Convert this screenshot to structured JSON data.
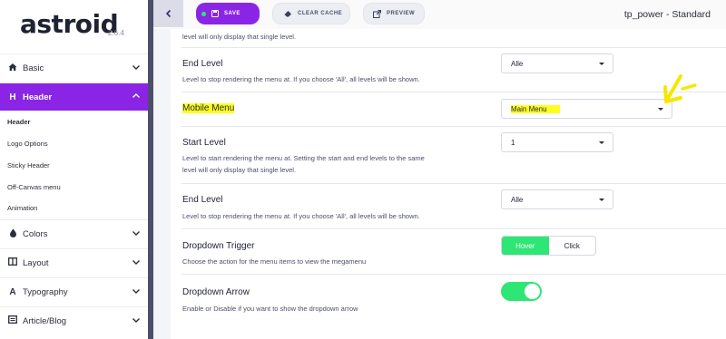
{
  "sidebar": {
    "logo": "astroid",
    "version": "2.6.4",
    "items": [
      {
        "label": "Basic",
        "icon": "home-icon"
      },
      {
        "label": "Header",
        "icon": "h-icon"
      },
      {
        "label": "Colors",
        "icon": "drop-icon"
      },
      {
        "label": "Layout",
        "icon": "layout-icon"
      },
      {
        "label": "Typography",
        "icon": "a-icon"
      },
      {
        "label": "Article/Blog",
        "icon": "document-icon"
      }
    ],
    "sub_items": [
      "Header",
      "Logo Options",
      "Sticky Header",
      "Off-Canvas menu",
      "Animation"
    ]
  },
  "toolbar": {
    "save": "SAVE",
    "clear_cache": "CLEAR CACHE",
    "preview": "PREVIEW",
    "title": "tp_power - Standard"
  },
  "fields": {
    "top_desc": "level will only display that single level.",
    "end_level_1": {
      "title": "End Level",
      "desc": "Level to stop rendering the menu at. If you choose 'All', all levels will be shown.",
      "value": "Alle"
    },
    "mobile_menu": {
      "title": "Mobile Menu",
      "value": "Main Menu"
    },
    "start_level": {
      "title": "Start Level",
      "desc1": "Level to start rendering the menu at. Setting the start and end levels to the same",
      "desc2": "level will only display that single level.",
      "value": "1"
    },
    "end_level_2": {
      "title": "End Level",
      "desc": "Level to stop rendering the menu at. If you choose 'All', all levels will be shown.",
      "value": "Alle"
    },
    "dropdown_trigger": {
      "title": "Dropdown Trigger",
      "desc": "Choose the action for the menu items to view the megamenu",
      "options": [
        "Hover",
        "Click"
      ],
      "selected": "Hover"
    },
    "dropdown_arrow": {
      "title": "Dropdown Arrow",
      "desc": "Enable or Disable if you want to show the dropdown arrow",
      "enabled": true
    }
  },
  "colors": {
    "accent": "#8a25e6",
    "success": "#2ee675",
    "highlight": "#ffff1f",
    "annotation": "#f5e800"
  }
}
